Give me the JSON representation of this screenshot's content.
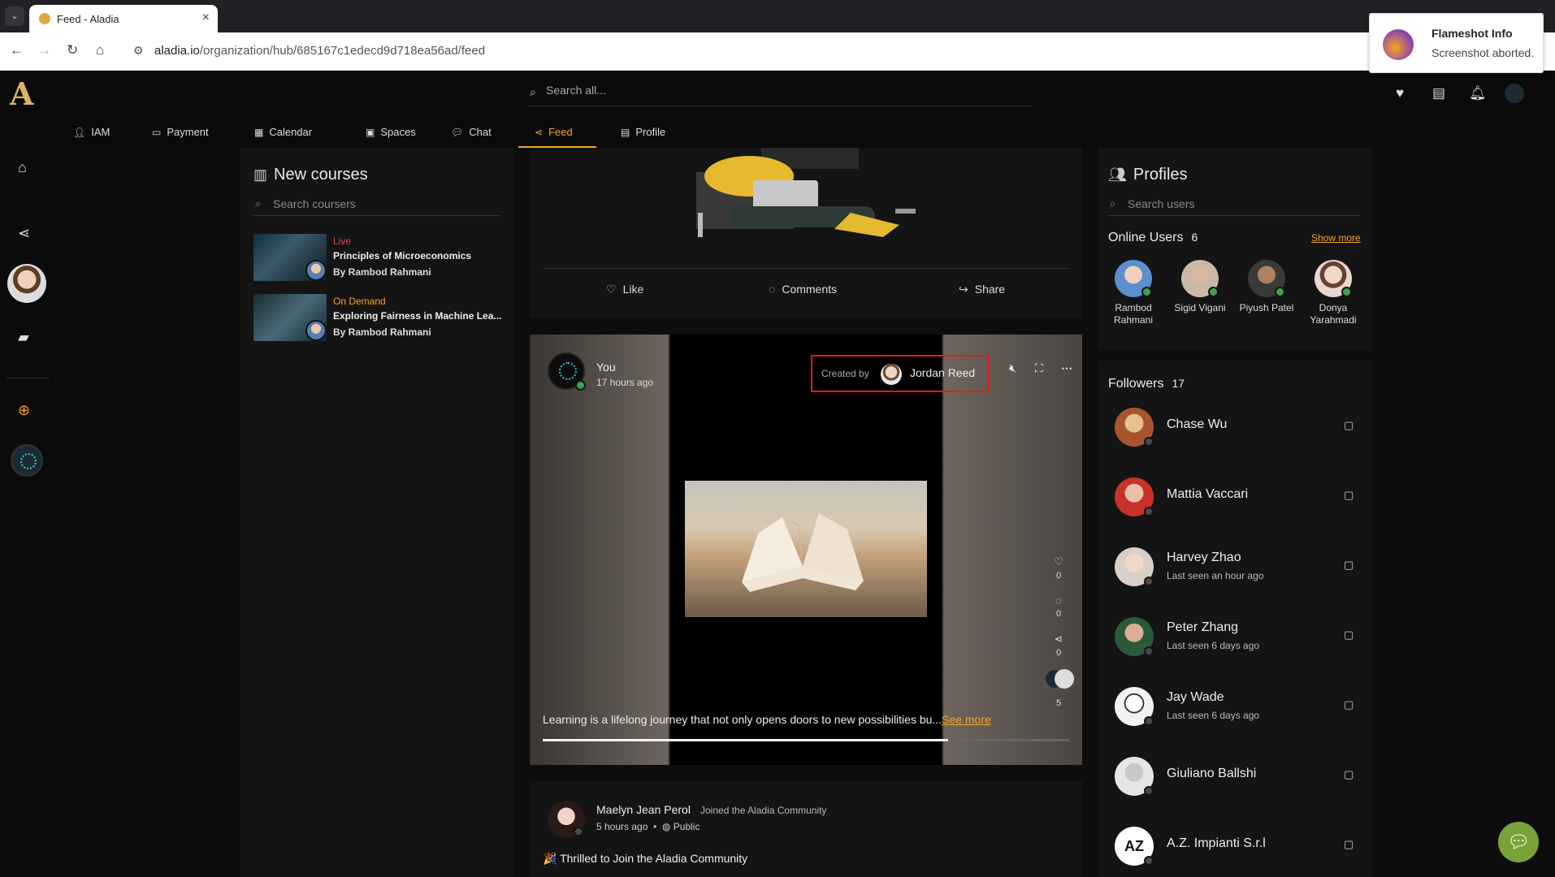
{
  "browser": {
    "tab_title": "Feed - Aladia",
    "url_host": "aladia.io",
    "url_path": "/organization/hub/685167c1edecd9d718ea56ad/feed"
  },
  "notification": {
    "title": "Flameshot Info",
    "message": "Screenshot aborted."
  },
  "header": {
    "search_placeholder": "Search all...",
    "menu": [
      {
        "label": "IAM",
        "icon": "person-icon"
      },
      {
        "label": "Payment",
        "icon": "card-icon"
      },
      {
        "label": "Calendar",
        "icon": "calendar-icon"
      },
      {
        "label": "Spaces",
        "icon": "spaces-icon"
      },
      {
        "label": "Chat",
        "icon": "chat-icon"
      },
      {
        "label": "Feed",
        "icon": "share-icon",
        "active": true
      },
      {
        "label": "Profile",
        "icon": "id-card-icon"
      }
    ]
  },
  "courses": {
    "title": "New courses",
    "search_placeholder": "Search coursers",
    "items": [
      {
        "badge": "Live",
        "badge_color": "#e0453a",
        "name": "Principles of Microeconomics",
        "by": "By Rambod Rahmani"
      },
      {
        "badge": "On Demand",
        "badge_color": "#f5a623",
        "name": "Exploring Fairness in Machine Lea...",
        "by": "By Rambod Rahmani"
      }
    ]
  },
  "feed": {
    "actions": {
      "like": "Like",
      "comments": "Comments",
      "share": "Share"
    },
    "video_post": {
      "author": "You",
      "time": "17 hours ago",
      "created_by_label": "Created by",
      "created_by_name": "Jordan Reed",
      "likes": "0",
      "comments": "0",
      "shares": "0",
      "views": "5",
      "caption": "Learning is a lifelong journey that not only opens doors to new possibilities bu...",
      "see_more": "See more",
      "progress": 0.77
    },
    "next_post": {
      "author": "Maelyn Jean Perol",
      "joined": "Joined the Aladia Community",
      "time": "5 hours ago",
      "visibility": "Public",
      "text": "🎉 Thrilled to Join the Aladia Community"
    }
  },
  "profiles": {
    "title": "Profiles",
    "search_placeholder": "Search users",
    "online_label": "Online Users",
    "online_count": "6",
    "show_more": "Show more",
    "online_users": [
      {
        "first": "Rambod",
        "last": "Rahmani",
        "color": "#5a8fd0"
      },
      {
        "first": "Sigid Vigani",
        "last": "",
        "color": "#c9b8a8"
      },
      {
        "first": "Piyush Patel",
        "last": "",
        "color": "#3a3a3a"
      },
      {
        "first": "Donya",
        "last": "Yarahmadi",
        "color": "#e8d8d0"
      }
    ],
    "followers_label": "Followers",
    "followers_count": "17",
    "followers": [
      {
        "name": "Chase Wu",
        "sub": "",
        "color": "#a8552e"
      },
      {
        "name": "Mattia Vaccari",
        "sub": "",
        "color": "#c8322a"
      },
      {
        "name": "Harvey Zhao",
        "sub": "Last seen an hour ago",
        "color": "#d8d0c8"
      },
      {
        "name": "Peter Zhang",
        "sub": "Last seen 6 days ago",
        "color": "#2a5a3a"
      },
      {
        "name": "Jay Wade",
        "sub": "Last seen 6 days ago",
        "color": "#f2f2f2"
      },
      {
        "name": "Giuliano Ballshi",
        "sub": "",
        "color": "#e6e6e6"
      },
      {
        "name": "A.Z. Impianti S.r.l",
        "sub": "",
        "color": "#ffffff"
      }
    ]
  }
}
